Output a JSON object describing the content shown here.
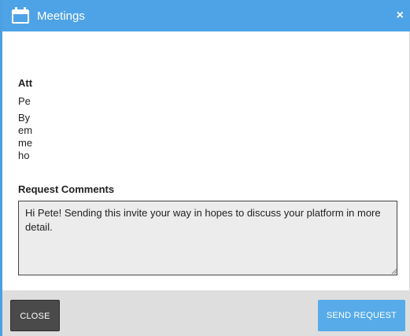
{
  "dialog": {
    "title": "Meetings",
    "close_glyph": "×",
    "icons": {
      "title": "calendar-icon",
      "close": "close-icon"
    },
    "accent_color": "#4ea3e6"
  },
  "attendee": {
    "label": "Att",
    "name": "Pe",
    "description_lines": [
      "By",
      "em",
      "me",
      "ho"
    ]
  },
  "request_comments": {
    "label": "Request Comments",
    "value": "Hi Pete! Sending this invite your way in hopes to discuss your platform in more detail."
  },
  "footer": {
    "close_label": "CLOSE",
    "send_label": "SEND REQUEST"
  }
}
